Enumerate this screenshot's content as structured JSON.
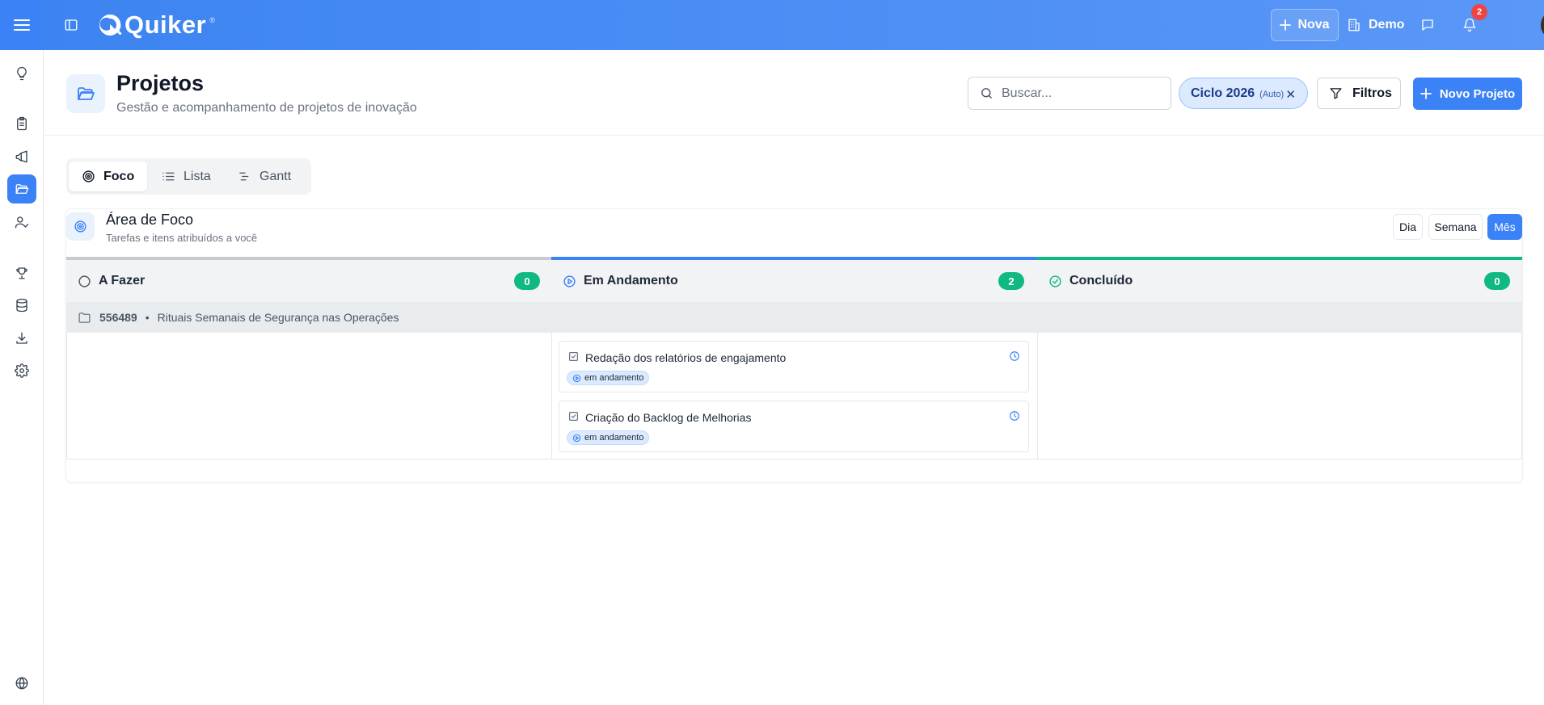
{
  "app": {
    "name": "Quiker",
    "registered": "®"
  },
  "topbar": {
    "new_label": "Nova",
    "workspace_label": "Demo",
    "notification_count": "2"
  },
  "sidebar": {
    "items": [
      {
        "name": "ideas",
        "icon": "lightbulb-icon",
        "active": false
      },
      {
        "name": "tasks",
        "icon": "clipboard-icon",
        "active": false
      },
      {
        "name": "campaigns",
        "icon": "megaphone-icon",
        "active": false
      },
      {
        "name": "projects",
        "icon": "folder-open-icon",
        "active": true
      },
      {
        "name": "users",
        "icon": "user-check-icon",
        "active": false
      },
      {
        "name": "ranking",
        "icon": "trophy-icon",
        "active": false
      },
      {
        "name": "database",
        "icon": "database-icon",
        "active": false
      },
      {
        "name": "downloads",
        "icon": "download-icon",
        "active": false
      },
      {
        "name": "settings",
        "icon": "gear-icon",
        "active": false
      },
      {
        "name": "language",
        "icon": "globe-icon",
        "active": false
      }
    ]
  },
  "header": {
    "title": "Projetos",
    "subtitle": "Gestão e acompanhamento de projetos de inovação",
    "search_placeholder": "Buscar...",
    "cycle_label": "Ciclo 2026",
    "cycle_mode": "(Auto)",
    "filters_label": "Filtros",
    "new_project_label": "Novo Projeto"
  },
  "tabs": [
    {
      "label": "Foco",
      "icon": "target-icon",
      "active": true
    },
    {
      "label": "Lista",
      "icon": "list-icon",
      "active": false
    },
    {
      "label": "Gantt",
      "icon": "gantt-icon",
      "active": false
    }
  ],
  "focus": {
    "title": "Área de Foco",
    "subtitle": "Tarefas e itens atribuídos a você",
    "periods": [
      {
        "label": "Dia",
        "active": false
      },
      {
        "label": "Semana",
        "active": false
      },
      {
        "label": "Mês",
        "active": true
      }
    ]
  },
  "board": {
    "columns": [
      {
        "title": "A Fazer",
        "count": "0",
        "color": "#c7cbd1",
        "icon": "circle-icon"
      },
      {
        "title": "Em Andamento",
        "count": "2",
        "color": "#3b82f6",
        "icon": "play-circle-icon"
      },
      {
        "title": "Concluído",
        "count": "0",
        "color": "#10b981",
        "icon": "check-circle-icon"
      }
    ],
    "group": {
      "code": "556489",
      "separator": "•",
      "name": "Rituais Semanais de Segurança nas Operações"
    },
    "tasks": [
      {
        "title": "Redação dos relatórios de engajamento",
        "status": "em andamento"
      },
      {
        "title": "Criação do Backlog de Melhorias",
        "status": "em andamento"
      }
    ]
  },
  "colors": {
    "accent": "#3b82f6",
    "success": "#10b981",
    "danger": "#ef4444"
  }
}
